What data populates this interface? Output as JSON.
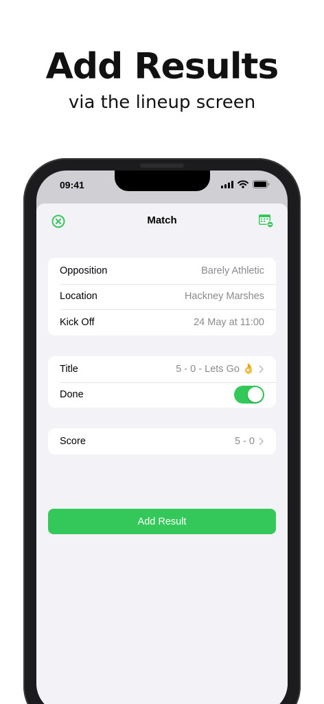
{
  "promo": {
    "headline": "Add Results",
    "subline": "via the lineup screen"
  },
  "status_bar": {
    "time": "09:41",
    "icons": [
      "signal-icon",
      "wifi-icon",
      "battery-icon"
    ]
  },
  "nav": {
    "title": "Match",
    "left_icon": "close-circle-icon",
    "right_icon": "calendar-remove-icon"
  },
  "details": [
    {
      "label": "Opposition",
      "value": "Barely Athletic"
    },
    {
      "label": "Location",
      "value": "Hackney Marshes"
    },
    {
      "label": "Kick Off",
      "value": "24 May at 11:00"
    }
  ],
  "result": {
    "title_label": "Title",
    "title_value": "5 - 0 - Lets Go 👌",
    "done_label": "Done",
    "done_on": true
  },
  "score": {
    "label": "Score",
    "value": "5 - 0"
  },
  "add_button": "Add Result",
  "colors": {
    "accent": "#34c759",
    "background": "#f2f2f7",
    "secondary_text": "#8a8a8e"
  }
}
